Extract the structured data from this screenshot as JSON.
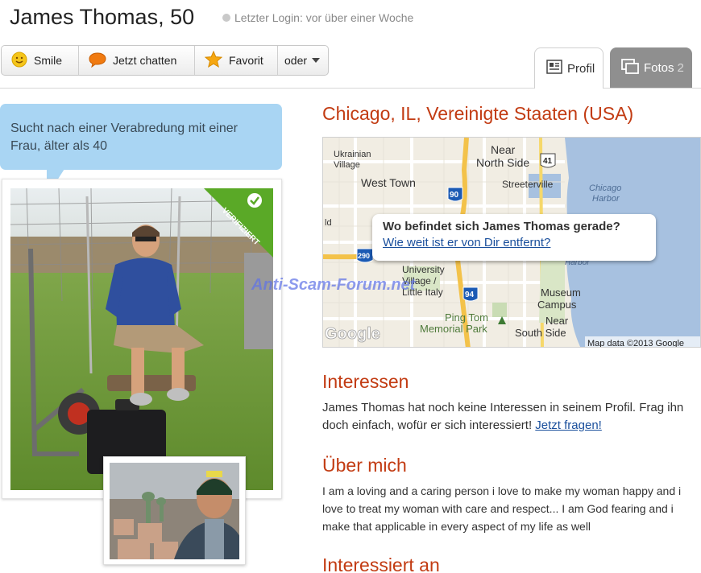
{
  "header": {
    "name": "James Thomas, 50",
    "last_login": "Letzter Login: vor über einer Woche"
  },
  "actions": {
    "smile": "Smile",
    "chat": "Jetzt chatten",
    "favorite": "Favorit",
    "more": "oder"
  },
  "tabs": {
    "profile": "Profil",
    "photos": "Fotos",
    "photos_count": "2"
  },
  "speech_bubble": {
    "text": "Sucht nach einer Verabredung mit einer Frau, älter als 40"
  },
  "photo": {
    "verified_badge": "VERIFIZIERT"
  },
  "location": {
    "title": "Chicago, IL, Vereinigte Staaten (USA)"
  },
  "map": {
    "labels": {
      "ukrainian_village": "Ukrainian\nVillage",
      "near_north_side": "Near\nNorth Side",
      "west_town": "West Town",
      "streeterville": "Streeterville",
      "chicago_harbor": "Chicago\nHarbor",
      "university_village": "University\nVillage /\nLittle Italy",
      "ping_tom": "Ping Tom\nMemorial Park",
      "museum_campus": "Museum\nCampus",
      "near_south_side": "Near\nSouth Side",
      "harbor": "Harbor",
      "ld": "ld",
      "route_41": "41",
      "route_90": "90",
      "route_290": "290",
      "route_94": "94"
    },
    "google_logo": "Google",
    "attribution": "Map data ©2013 Google",
    "popup_title": "Wo befindet sich James Thomas gerade?",
    "popup_link": "Wie weit ist er von Dir entfernt?"
  },
  "watermark": "Anti-Scam-Forum.net",
  "interests": {
    "title": "Interessen",
    "text": "James Thomas hat noch keine Interessen in seinem Profil. Frag ihn doch einfach, wofür er sich interessiert!",
    "link": "Jetzt fragen!"
  },
  "about": {
    "title": "Über mich",
    "text": "I am a loving and a caring person i love to make my woman happy and i love to treat my woman with care and respect... I am God fearing and i make that applicable in every aspect of my life as well"
  },
  "interested_in": {
    "title": "Interessiert an"
  },
  "colors": {
    "accent_red": "#c23b12",
    "bubble_blue": "#a9d5f3",
    "link_blue": "#1a4f9c",
    "verified_green": "#5aa927",
    "tab_inactive": "#8f8f8f"
  },
  "icons": {
    "smile": "smiley-icon",
    "chat": "chat-bubble-icon",
    "favorite": "star-icon",
    "profile": "profile-card-icon",
    "photos": "photos-stack-icon",
    "status": "status-dot-icon"
  }
}
